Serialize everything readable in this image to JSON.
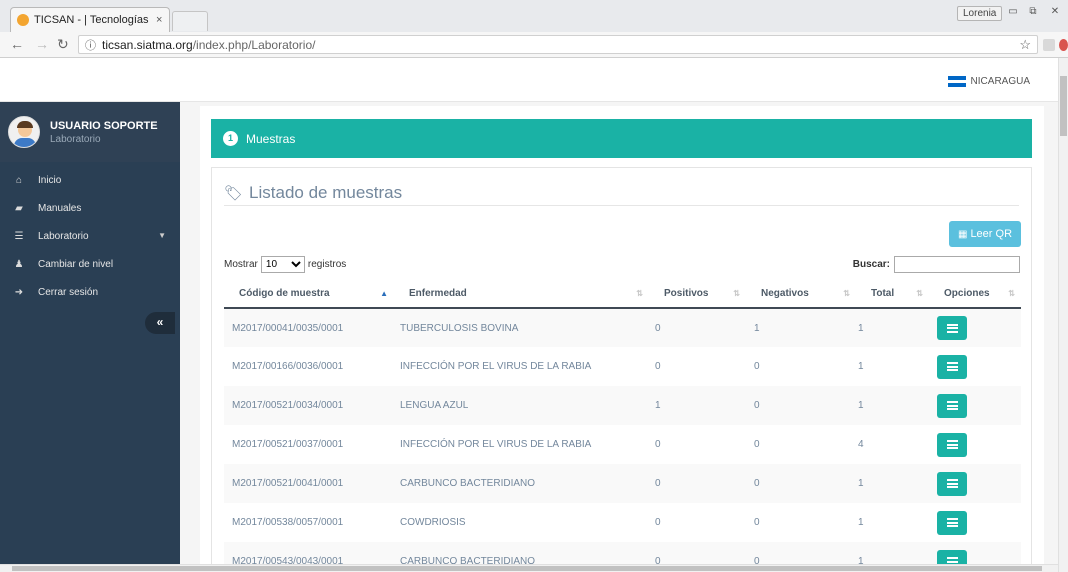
{
  "browser": {
    "tab_title": "TICSAN - | Tecnologías d",
    "tab_close": "×",
    "user_chip": "Lorenia",
    "url_prefix": "ticsan.siatma.org",
    "url_path": "/index.php/Laboratorio/"
  },
  "header": {
    "country": "NICARAGUA",
    "flag_colors": [
      "#0067c6",
      "#ffffff",
      "#0067c6"
    ]
  },
  "sidebar": {
    "user_name": "USUARIO SOPORTE",
    "user_role": "Laboratorio",
    "items": [
      {
        "label": "Inicio",
        "icon": "home-icon"
      },
      {
        "label": "Manuales",
        "icon": "book-icon"
      },
      {
        "label": "Laboratorio",
        "icon": "list-icon"
      },
      {
        "label": "Cambiar de nivel",
        "icon": "users-icon"
      },
      {
        "label": "Cerrar sesión",
        "icon": "sign-out-icon"
      }
    ],
    "collapse_label": "«"
  },
  "wizard": {
    "step_number": "1",
    "step_label": "Muestras"
  },
  "card": {
    "title": "Listado de muestras",
    "qr_button": "Leer QR",
    "length_prefix": "Mostrar",
    "length_value": "10",
    "length_suffix": "registros",
    "search_label": "Buscar:",
    "search_value": ""
  },
  "table": {
    "columns": [
      "Código de muestra",
      "Enfermedad",
      "Positivos",
      "Negativos",
      "Total",
      "Opciones"
    ],
    "rows": [
      {
        "codigo": "M2017/00041/0035/0001",
        "enfermedad": "TUBERCULOSIS BOVINA",
        "positivos": "0",
        "negativos": "1",
        "total": "1"
      },
      {
        "codigo": "M2017/00166/0036/0001",
        "enfermedad": "INFECCIÓN POR EL VIRUS DE LA RABIA",
        "positivos": "0",
        "negativos": "0",
        "total": "1"
      },
      {
        "codigo": "M2017/00521/0034/0001",
        "enfermedad": "LENGUA AZUL",
        "positivos": "1",
        "negativos": "0",
        "total": "1"
      },
      {
        "codigo": "M2017/00521/0037/0001",
        "enfermedad": "INFECCIÓN POR EL VIRUS DE LA RABIA",
        "positivos": "0",
        "negativos": "0",
        "total": "4"
      },
      {
        "codigo": "M2017/00521/0041/0001",
        "enfermedad": "CARBUNCO BACTERIDIANO",
        "positivos": "0",
        "negativos": "0",
        "total": "1"
      },
      {
        "codigo": "M2017/00538/0057/0001",
        "enfermedad": "COWDRIOSIS",
        "positivos": "0",
        "negativos": "0",
        "total": "1"
      },
      {
        "codigo": "M2017/00543/0043/0001",
        "enfermedad": "CARBUNCO BACTERIDIANO",
        "positivos": "0",
        "negativos": "0",
        "total": "1"
      }
    ]
  },
  "colors": {
    "accent": "#1ab2a5",
    "sidebar": "#2a3f54",
    "info_button": "#5bc0de"
  }
}
